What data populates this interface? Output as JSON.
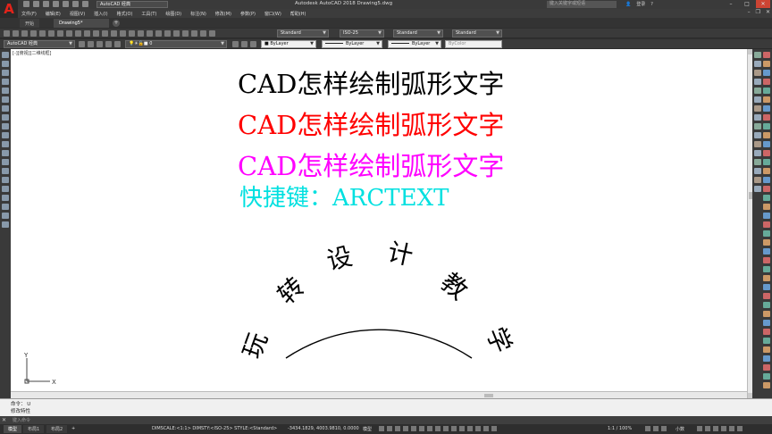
{
  "titlebar": {
    "logo": "A",
    "workspace": "AutoCAD 经典",
    "title": "Autodesk AutoCAD 2018    Drawing5.dwg",
    "search_placeholder": "键入关键字或短语",
    "signin": "登录"
  },
  "menubar": {
    "items": [
      "文件(F)",
      "编辑(E)",
      "视图(V)",
      "插入(I)",
      "格式(O)",
      "工具(T)",
      "绘图(D)",
      "标注(N)",
      "修改(M)",
      "参数(P)",
      "窗口(W)",
      "帮助(H)"
    ]
  },
  "tabs": {
    "items": [
      "开始",
      "Drawing5*"
    ],
    "add": "+"
  },
  "toolbar": {
    "text_style": "Standard",
    "dim_style": "ISO-25",
    "table_style": "Standard",
    "mleader_style": "Standard",
    "workspace": "AutoCAD 经典",
    "layer": "0",
    "color": "ByLayer",
    "linetype": "ByLayer",
    "lineweight": "ByLayer",
    "plotstyle": "ByColor"
  },
  "canvas": {
    "view_label": "[-][俯视][二维线框]",
    "lines": [
      {
        "text": "CAD怎样绘制弧形文字",
        "color": "#000000"
      },
      {
        "text": "CAD怎样绘制弧形文字",
        "color": "#ff0000"
      },
      {
        "text": "CAD怎样绘制弧形文字",
        "color": "#ff00ff"
      },
      {
        "text": "快捷键：ARCTEXT",
        "color": "#00e0e0"
      }
    ],
    "arc_text": [
      "玩",
      "转",
      "设",
      "计",
      "教",
      "学"
    ],
    "ucs": {
      "x": "X",
      "y": "Y"
    }
  },
  "command": {
    "history_1": "命令： U",
    "history_2": "修改特性",
    "prompt": "键入命令"
  },
  "status": {
    "layout_tabs": [
      "模型",
      "布局1",
      "布局2"
    ],
    "dim_info": "DIMSCALE:<1:1> DIMSTY:<ISO-25> STYLE:<Standard>",
    "coords": "-3434.1829, 4003.9810, 0.0000",
    "model": "模型",
    "scale": "1:1 / 100%",
    "unit": "小数"
  }
}
